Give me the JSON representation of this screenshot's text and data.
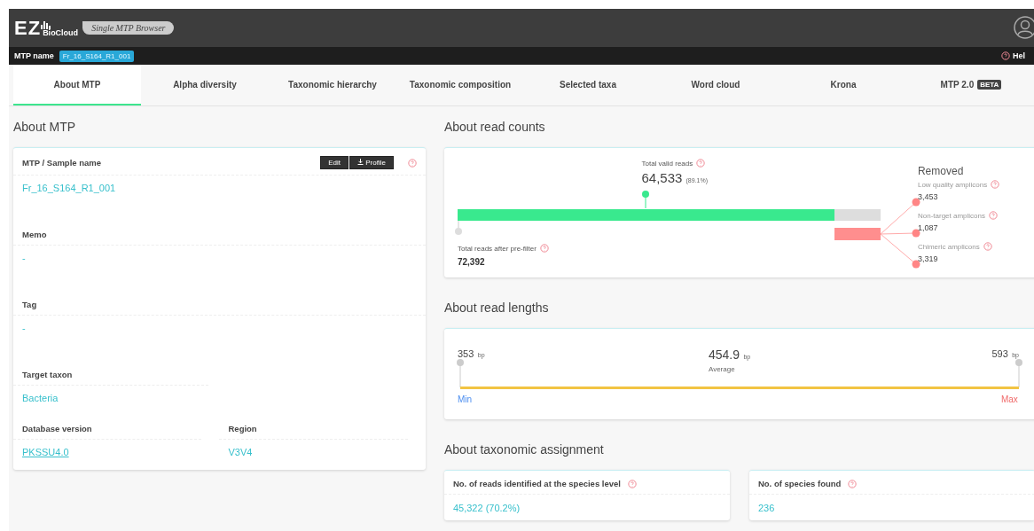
{
  "header": {
    "logo_main": "EZ",
    "logo_sub": "BioCloud",
    "subtitle": "Single MTP Browser",
    "mtp_name_label": "MTP name",
    "mtp_name": "Fr_16_S164_R1_001",
    "help": "Hel"
  },
  "tabs": [
    {
      "label": "About MTP",
      "selected": true
    },
    {
      "label": "Alpha diversity",
      "selected": false
    },
    {
      "label": "Taxonomic hierarchy",
      "selected": false
    },
    {
      "label": "Taxonomic composition",
      "selected": false
    },
    {
      "label": "Selected taxa",
      "selected": false
    },
    {
      "label": "Word cloud",
      "selected": false
    },
    {
      "label": "Krona",
      "selected": false
    },
    {
      "label": "MTP 2.0",
      "selected": false,
      "badge": "BETA"
    }
  ],
  "about_mtp": {
    "title": "About MTP",
    "buttons": [
      "Edit",
      "Profile"
    ],
    "fields": [
      {
        "label": "MTP / Sample name",
        "value": "Fr_16_S164_R1_001"
      },
      {
        "label": "Memo",
        "value": "-"
      },
      {
        "label": "Tag",
        "value": "-"
      },
      {
        "label": "Target taxon",
        "value": "Bacteria"
      }
    ],
    "pair": [
      {
        "label": "Database version",
        "value": "PKSSU4.0",
        "kind": "link"
      },
      {
        "label": "Region",
        "value": "V3V4",
        "kind": "text"
      }
    ]
  },
  "read_counts": {
    "title": "About read counts",
    "valid_label": "Total valid reads",
    "valid_value": "64,533",
    "valid_percent": "(89.1%)",
    "level": 0.891,
    "prefilter_label": "Total reads after pre-filter",
    "prefilter_value": "72,392",
    "removed_title": "Removed",
    "removed": [
      {
        "label": "Low quality amplicons",
        "value": "3,453"
      },
      {
        "label": "Non-target amplicons",
        "value": "1,087"
      },
      {
        "label": "Chimeric amplicons",
        "value": "3,319"
      }
    ]
  },
  "read_lengths": {
    "title": "About read lengths",
    "min": "353",
    "average": "454.9",
    "max": "593",
    "min_unit": "bp",
    "average_unit": "bp",
    "max_unit": "bp",
    "average_label": "Average",
    "min_label": "Min",
    "max_label": "Max"
  },
  "taxonomic": {
    "title": "About taxonomic assignment",
    "cards": [
      {
        "label": "No. of reads identified at the species level",
        "value": "45,322 (70.2%)"
      },
      {
        "label": "No. of species found",
        "value": "236"
      }
    ]
  }
}
